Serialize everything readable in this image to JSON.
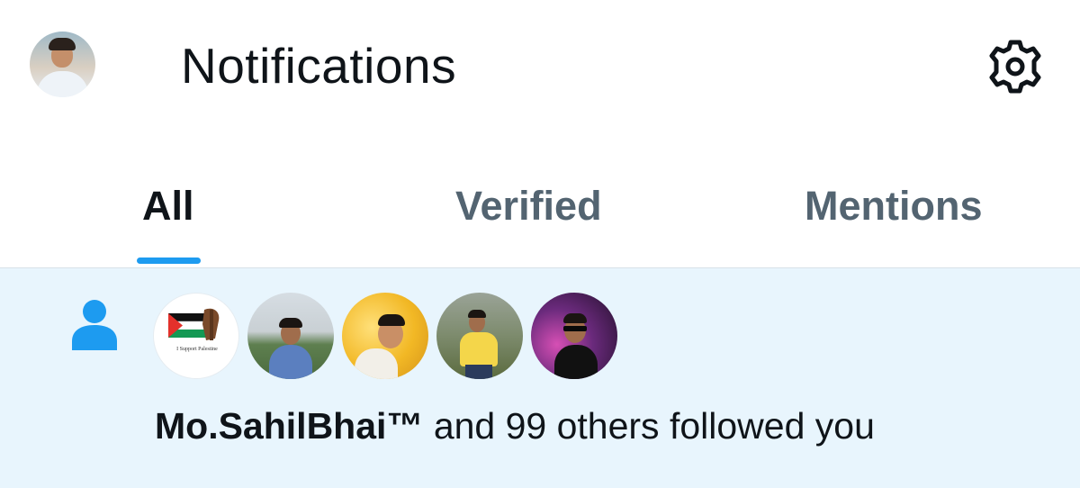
{
  "header": {
    "title": "Notifications",
    "settings_icon": "gear-icon"
  },
  "tabs": [
    {
      "label": "All",
      "active": true
    },
    {
      "label": "Verified",
      "active": false
    },
    {
      "label": "Mentions",
      "active": false
    }
  ],
  "notification": {
    "type_icon": "person-icon",
    "actor": "Mo.SahilBhai™",
    "message": " and 99 others followed you",
    "poster_text": "I Support Palestine"
  },
  "colors": {
    "accent": "#1d9bf0",
    "text_primary": "#0f1419",
    "text_secondary": "#536471",
    "highlight_bg": "#e8f5fd"
  }
}
